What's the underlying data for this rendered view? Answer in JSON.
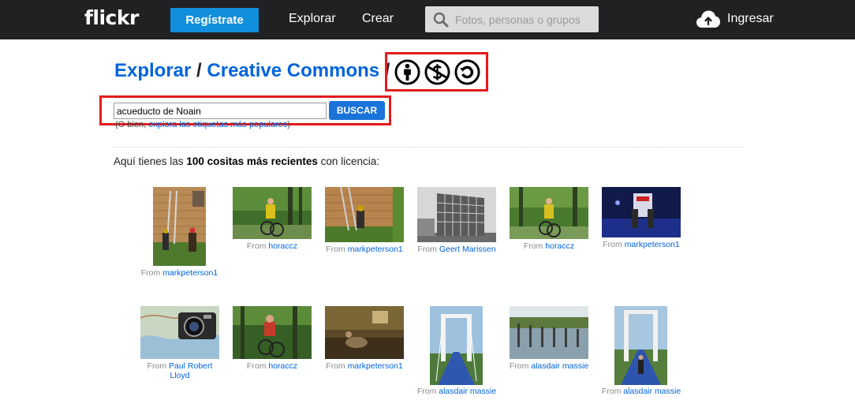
{
  "topbar": {
    "logo": "flickr",
    "signup": "Regístrate",
    "explore": "Explorar",
    "create": "Crear",
    "search_placeholder": "Fotos, personas o grupos",
    "login": "Ingresar"
  },
  "heading": {
    "explore": "Explorar",
    "separator": "/",
    "section": "Creative Commons",
    "trailing": "/",
    "license_icons": [
      "attribution-icon",
      "noncommercial-icon",
      "sharealike-icon"
    ]
  },
  "search": {
    "value": "acueducto de Noain",
    "button": "BUSCAR",
    "hint_prefix": "(O bien, ",
    "hint_link": "explora las etiquetas más populares",
    "hint_suffix": ")"
  },
  "intro": {
    "before": "Aquí tienes las ",
    "bold": "100 cositas más recientes",
    "after": " con licencia:"
  },
  "from_label": "From",
  "photos": [
    {
      "author": "markpeterson1"
    },
    {
      "author": "horaccz"
    },
    {
      "author": "markpeterson1"
    },
    {
      "author": "Geert Marissen"
    },
    {
      "author": "horaccz"
    },
    {
      "author": "markpeterson1"
    },
    {
      "author_line1": "Paul Robert",
      "author_line2": "Lloyd"
    },
    {
      "author": "horaccz"
    },
    {
      "author": "markpeterson1"
    },
    {
      "author": "alasdair massie"
    },
    {
      "author": "alasdair massie"
    },
    {
      "author": "alasdair massie"
    }
  ],
  "colors": {
    "topbar": "#212124",
    "accent": "#128fdc",
    "link": "#0063dc",
    "highlight": "#e31b1b"
  }
}
